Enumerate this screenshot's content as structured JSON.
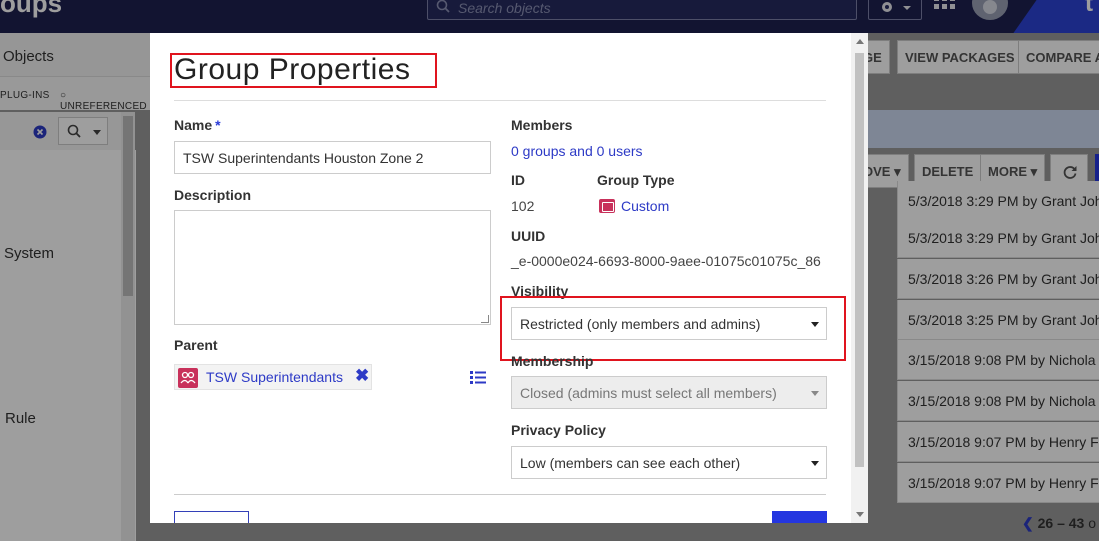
{
  "app": {
    "title_fragment": "oups",
    "search_placeholder": "Search objects",
    "brand_fragment": "t"
  },
  "background": {
    "objects_label": "Objects",
    "filters": [
      "PLUG-INS",
      "UNREFERENCED"
    ],
    "tree_items": [
      "System",
      "Rule"
    ],
    "top_buttons": [
      "GE",
      "VIEW PACKAGES",
      "COMPARE A"
    ],
    "action_buttons": [
      "OVE",
      "DELETE",
      "MORE"
    ],
    "rows": [
      "5/3/2018 3:29 PM by Grant Joh",
      "5/3/2018 3:29 PM by Grant Joh",
      "5/3/2018 3:26 PM by Grant Joh",
      "5/3/2018 3:25 PM by Grant Joh",
      "3/15/2018 9:08 PM by Nichola",
      "3/15/2018 9:08 PM by Nichola",
      "3/15/2018 9:07 PM by Henry F",
      "3/15/2018 9:07 PM by Henry F"
    ],
    "pager": {
      "range": "26 – 43",
      "suffix": "o"
    }
  },
  "modal": {
    "title": "Group Properties",
    "name": {
      "label": "Name",
      "required_mark": "*",
      "value": "TSW Superintendants Houston Zone 2"
    },
    "description": {
      "label": "Description",
      "value": ""
    },
    "parent": {
      "label": "Parent",
      "value": "TSW Superintendants",
      "remove_glyph": "✖"
    },
    "members": {
      "label": "Members",
      "value": "0 groups and 0 users"
    },
    "id": {
      "label": "ID",
      "value": "102"
    },
    "group_type": {
      "label": "Group Type",
      "value": "Custom"
    },
    "uuid": {
      "label": "UUID",
      "value": "_e-0000e024-6693-8000-9aee-01075c01075c_86"
    },
    "visibility": {
      "label": "Visibility",
      "value": "Restricted (only members and admins)"
    },
    "membership": {
      "label": "Membership",
      "value": "Closed (admins must select all members)"
    },
    "privacy": {
      "label": "Privacy Policy",
      "value": "Low (members can see each other)"
    }
  },
  "colors": {
    "accent": "#2436e0",
    "nav": "#1d2150",
    "highlight": "#e0141e",
    "group_icon": "#c8315b"
  },
  "icons": [
    "search-icon",
    "gear-icon",
    "apps-grid-icon",
    "avatar",
    "clear-icon",
    "refresh-icon",
    "group-icon",
    "list-icon",
    "chevron-left-icon"
  ]
}
